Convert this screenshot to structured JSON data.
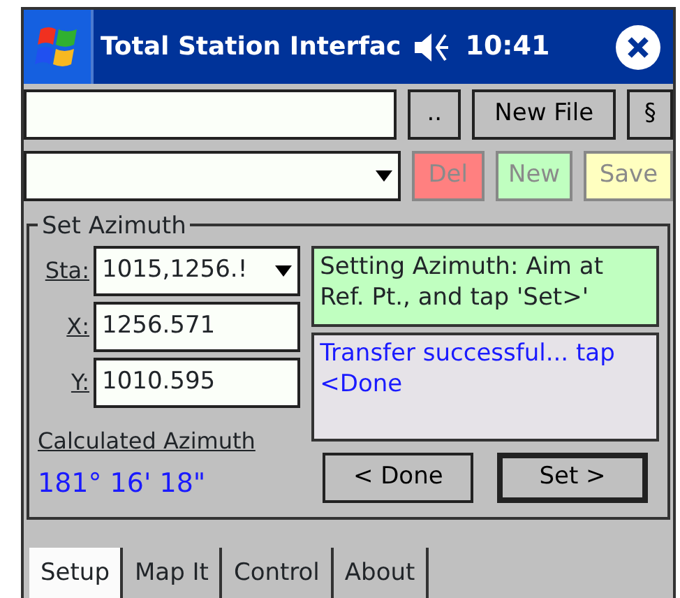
{
  "window": {
    "title": "Total Station Interfac",
    "time": "10:41"
  },
  "file_row": {
    "buttons": [
      {
        "label": "..",
        "disabled": false
      },
      {
        "label": "New File",
        "disabled": false
      },
      {
        "label": "§",
        "disabled": false
      }
    ]
  },
  "record_row": {
    "buttons": [
      {
        "label": "Del",
        "disabled": true,
        "color": "#ff8080"
      },
      {
        "label": "New",
        "disabled": true,
        "color": "#c0ffc0"
      },
      {
        "label": "Save",
        "disabled": true,
        "color": "#ffffc0"
      }
    ]
  },
  "set_azimuth": {
    "title": "Set Azimuth",
    "fields": [
      {
        "kind": "combo",
        "label": "Sta:",
        "value": "1015,1256.!"
      },
      {
        "kind": "text",
        "label": "X:",
        "value": "1256.571"
      },
      {
        "kind": "text",
        "label": "Y:",
        "value": "1010.595"
      }
    ],
    "calculated_label": "Calculated Azimuth",
    "calculated_value": "181° 16' 18\"",
    "instruction": "Setting Azimuth: Aim at Ref. Pt., and tap 'Set>'",
    "message": "Transfer successful... tap <Done",
    "buttons": [
      {
        "label": "< Done",
        "default": false
      },
      {
        "label": "Set >",
        "default": true
      }
    ]
  },
  "tabs": [
    {
      "label": "Setup",
      "selected": true
    },
    {
      "label": "Map It",
      "selected": false
    },
    {
      "label": "Control",
      "selected": false
    },
    {
      "label": "About",
      "selected": false
    }
  ]
}
